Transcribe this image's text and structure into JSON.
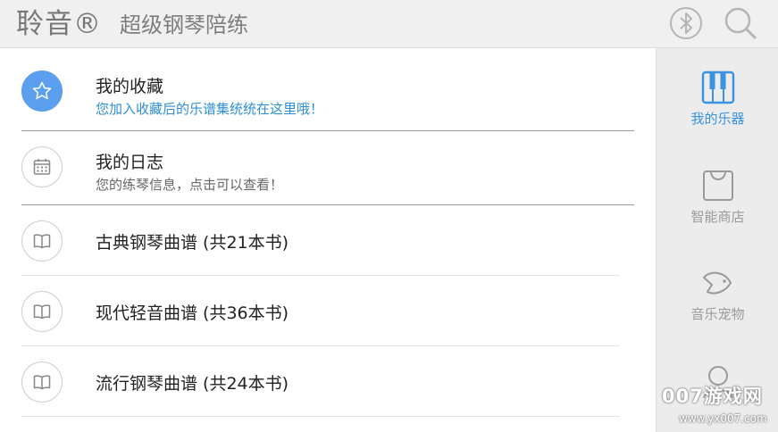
{
  "appbar": {
    "brand": "聆音®",
    "subtitle": "超级钢琴陪练",
    "bluetooth_icon": "bluetooth-icon",
    "search_icon": "search-icon"
  },
  "list": {
    "favorites": {
      "title": "我的收藏",
      "desc": "您加入收藏后的乐谱集统统在这里哦！",
      "icon": "star-icon"
    },
    "journal": {
      "title": "我的日志",
      "desc": "您的练琴信息，点击可以查看！",
      "icon": "calendar-icon"
    },
    "books": [
      {
        "title": "古典钢琴曲谱 (共21本书)",
        "icon": "book-icon"
      },
      {
        "title": "现代轻音曲谱 (共36本书)",
        "icon": "book-icon"
      },
      {
        "title": "流行钢琴曲谱 (共24本书)",
        "icon": "book-icon"
      }
    ]
  },
  "sidebar": {
    "items": [
      {
        "label": "我的乐器",
        "icon": "piano-keys-icon",
        "active": true
      },
      {
        "label": "智能商店",
        "icon": "shopping-bag-icon",
        "active": false
      },
      {
        "label": "音乐宠物",
        "icon": "fish-icon",
        "active": false
      },
      {
        "label": "",
        "icon": "user-icon",
        "active": false
      }
    ]
  },
  "watermark": {
    "text": "007游戏网",
    "url": "www.yx007.com"
  },
  "colors": {
    "accent": "#3a92e0",
    "favorite_circle": "#5b9fee",
    "desc_blue": "#2e8fd6",
    "sidebar_bg": "#ececec",
    "appbar_bg": "#f0f0f0"
  }
}
